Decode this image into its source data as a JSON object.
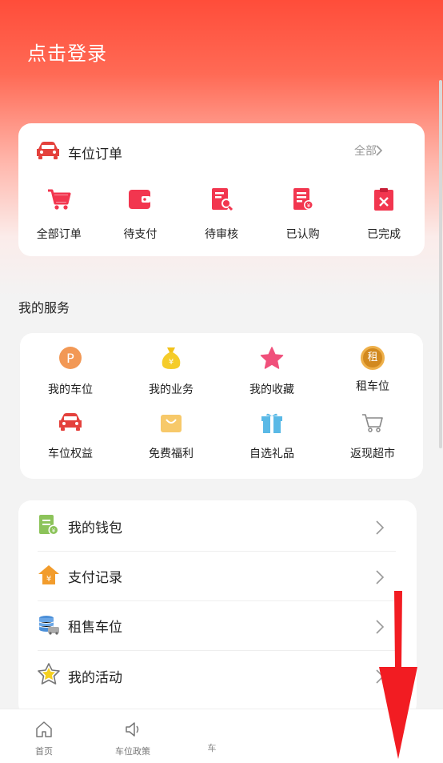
{
  "header": {
    "login_text": "点击登录"
  },
  "orders": {
    "title": "车位订单",
    "all_label": "全部",
    "items": [
      {
        "label": "全部订单",
        "icon": "cart-icon"
      },
      {
        "label": "待支付",
        "icon": "wallet-icon"
      },
      {
        "label": "待审核",
        "icon": "review-doc-icon"
      },
      {
        "label": "已认购",
        "icon": "subscribed-doc-icon"
      },
      {
        "label": "已完成",
        "icon": "completed-clipboard-icon"
      }
    ]
  },
  "services": {
    "title": "我的服务",
    "items": [
      {
        "label": "我的车位",
        "icon": "parking-p-icon"
      },
      {
        "label": "我的业务",
        "icon": "money-bag-icon"
      },
      {
        "label": "我的收藏",
        "icon": "star-icon"
      },
      {
        "label": "租车位",
        "icon": "rent-badge-icon",
        "badge": "租"
      },
      {
        "label": "车位权益",
        "icon": "car-icon"
      },
      {
        "label": "免费福利",
        "icon": "shopping-bag-icon"
      },
      {
        "label": "自选礼品",
        "icon": "gift-icon"
      },
      {
        "label": "返现超市",
        "icon": "shopping-cart-outline-icon"
      }
    ]
  },
  "menu": {
    "items": [
      {
        "label": "我的钱包",
        "icon": "wallet-doc-icon"
      },
      {
        "label": "支付记录",
        "icon": "yuan-house-icon"
      },
      {
        "label": "租售车位",
        "icon": "coins-car-icon"
      },
      {
        "label": "我的活动",
        "icon": "star-badge-icon"
      }
    ]
  },
  "tabbar": {
    "items": [
      {
        "label": "首页",
        "icon": "home-icon"
      },
      {
        "label": "车位政策",
        "icon": "speaker-icon"
      },
      {
        "label": "车",
        "icon": ""
      }
    ]
  },
  "colors": {
    "accent": "#f2364f",
    "hero": "#ff4d3a"
  }
}
